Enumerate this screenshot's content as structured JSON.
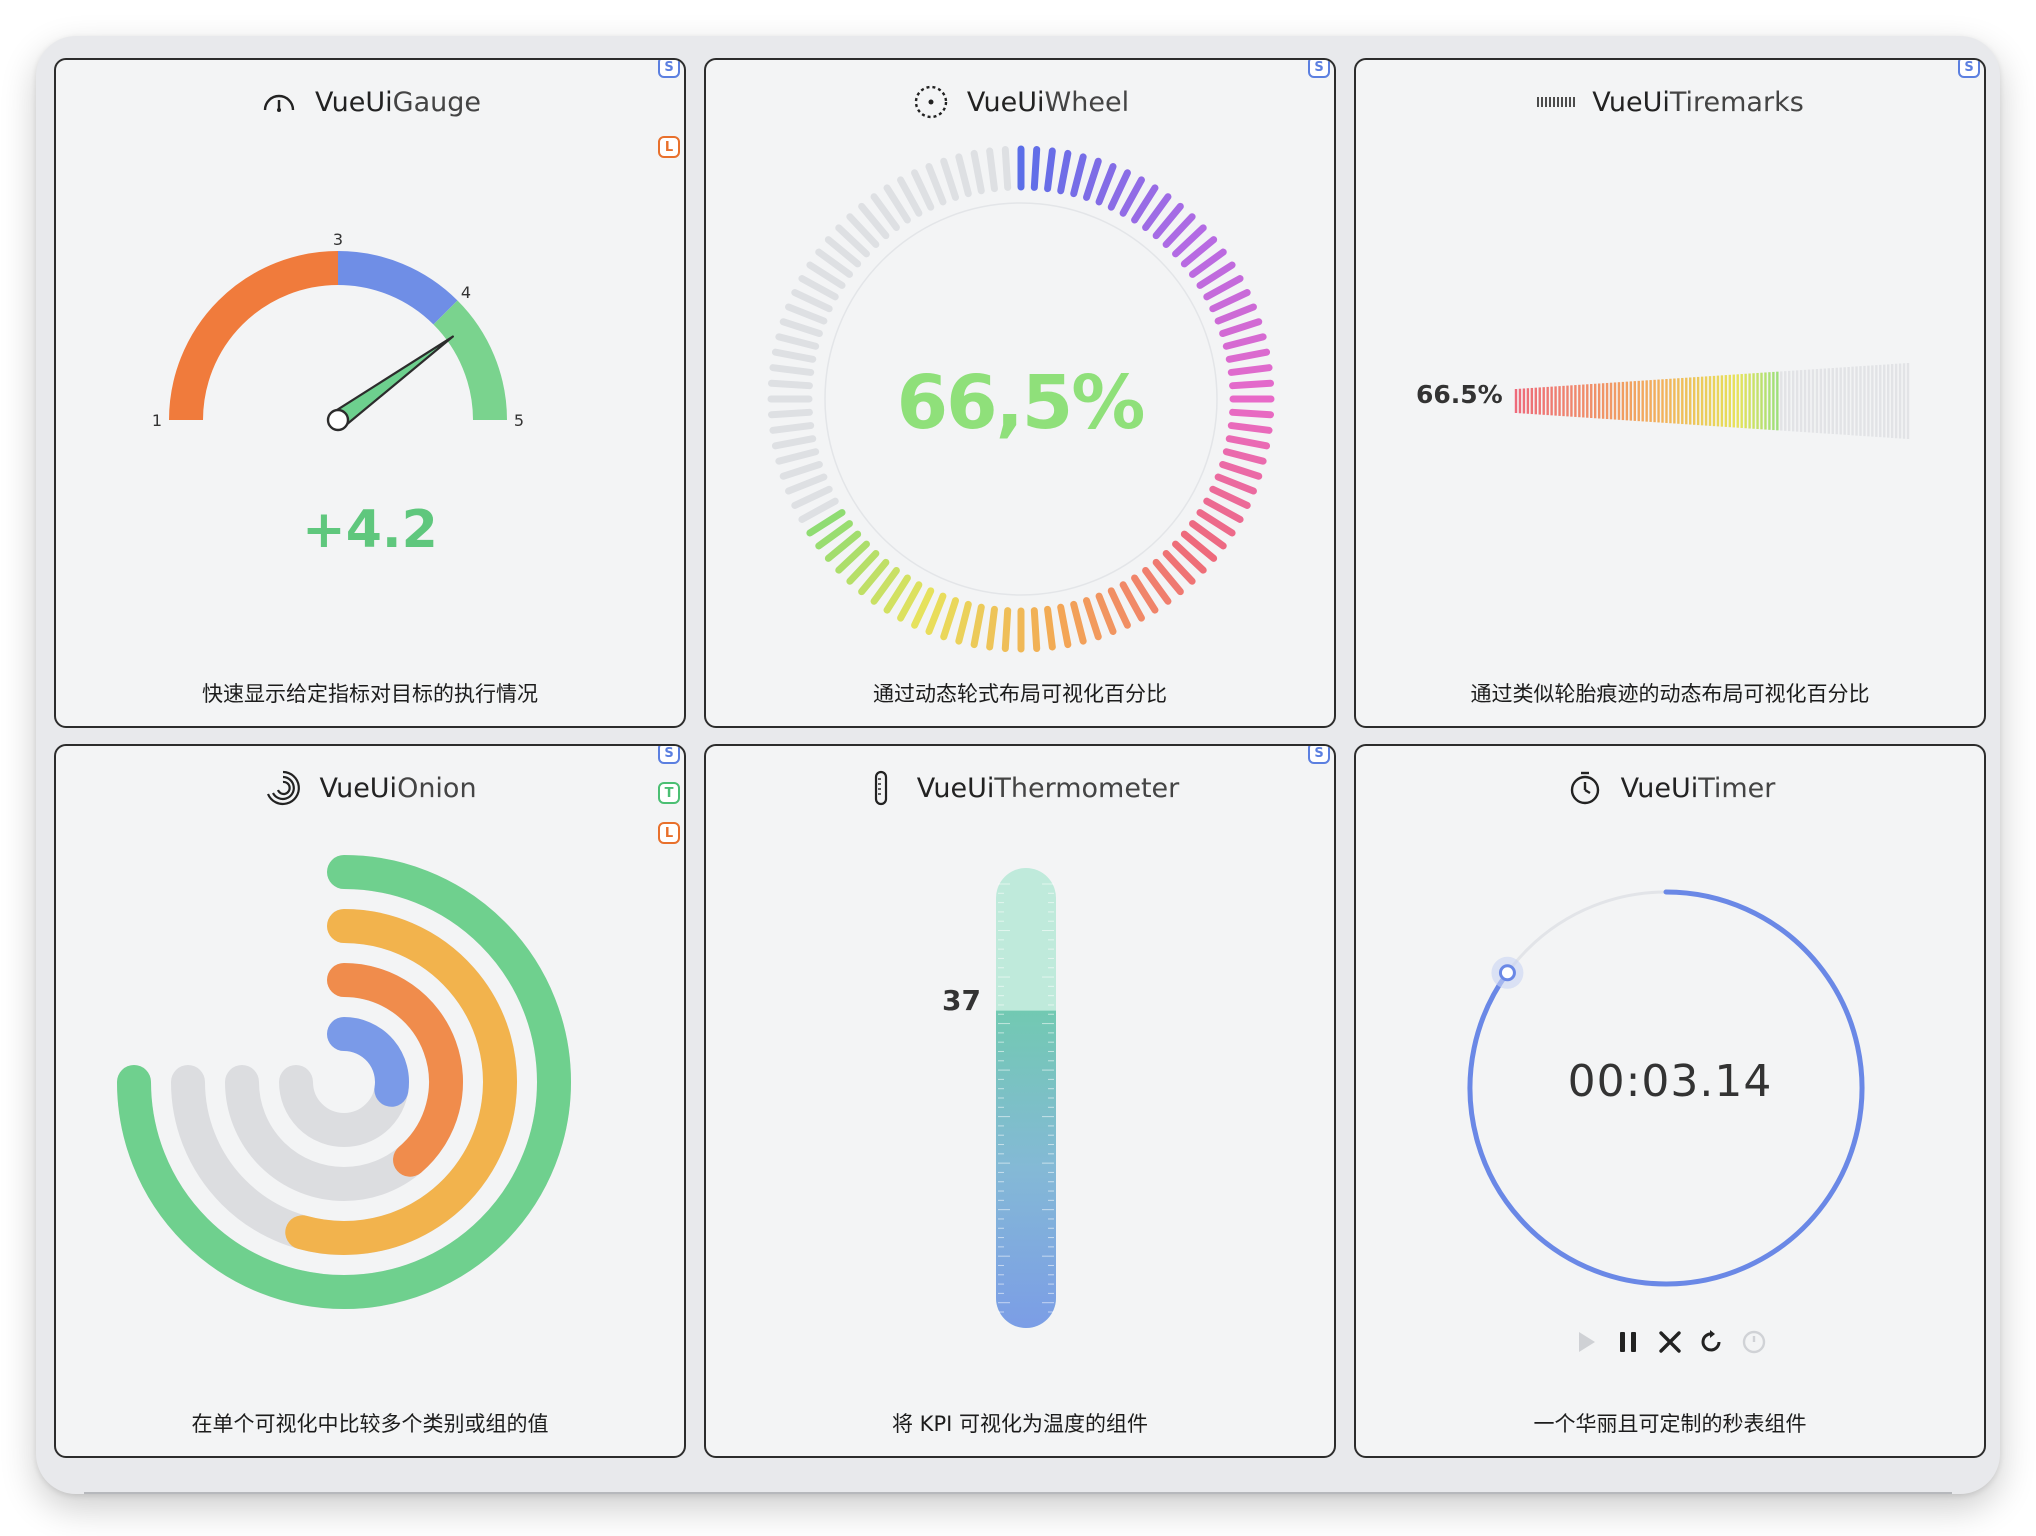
{
  "colors": {
    "card_bg": "#f3f4f5",
    "border": "#2c2c2c",
    "badge_s": "#5b7fe0",
    "badge_t": "#4bbf73",
    "badge_l": "#e8702c",
    "gauge_orange": "#f07b3c",
    "gauge_blue": "#6f8ee6",
    "gauge_green": "#7ad38e",
    "gauge_value": "#5fc77d",
    "wheel_value": "#8fe07a",
    "onion_green": "#6fd08e",
    "onion_yellow": "#f2b34d",
    "onion_orange": "#f08c4c",
    "onion_blue": "#7a9ae8",
    "thermo_top": "#a8e6cd",
    "thermo_bottom": "#7b9de6",
    "timer_ring": "#6a88e6"
  },
  "cards": [
    {
      "id": "gauge",
      "title_prefix": "VueUi",
      "title_suffix": "Gauge",
      "icon": "gauge-icon",
      "description": "快速显示给定指标对目标的执行情况",
      "badges": [
        "S",
        "L"
      ]
    },
    {
      "id": "wheel",
      "title_prefix": "VueUi",
      "title_suffix": "Wheel",
      "icon": "wheel-icon",
      "description": "通过动态轮式布局可视化百分比",
      "badges": [
        "S"
      ]
    },
    {
      "id": "tiremarks",
      "title_prefix": "VueUi",
      "title_suffix": "Tiremarks",
      "icon": "tiremarks-icon",
      "description": "通过类似轮胎痕迹的动态布局可视化百分比",
      "badges": [
        "S"
      ]
    },
    {
      "id": "onion",
      "title_prefix": "VueUi",
      "title_suffix": "Onion",
      "icon": "onion-icon",
      "description": "在单个可视化中比较多个类别或组的值",
      "badges": [
        "S",
        "T",
        "L"
      ]
    },
    {
      "id": "thermometer",
      "title_prefix": "VueUi",
      "title_suffix": "Thermometer",
      "icon": "thermometer-icon",
      "description": "将 KPI 可视化为温度的组件",
      "badges": [
        "S"
      ]
    },
    {
      "id": "timer",
      "title_prefix": "VueUi",
      "title_suffix": "Timer",
      "icon": "stopwatch-icon",
      "description": "一个华丽且可定制的秒表组件",
      "badges": []
    }
  ],
  "gauge": {
    "min": 1,
    "max": 5,
    "segments": [
      {
        "from": 1,
        "to": 3,
        "color": "#f07b3c"
      },
      {
        "from": 3,
        "to": 4,
        "color": "#6f8ee6"
      },
      {
        "from": 4,
        "to": 5,
        "color": "#7ad38e"
      }
    ],
    "tick_labels": [
      "1",
      "3",
      "4",
      "5"
    ],
    "tick_values": [
      1,
      3,
      4,
      5
    ],
    "needle_value": 4.2,
    "value_label": "+4.2"
  },
  "wheel": {
    "percentage": 66.5,
    "value_label": "66,5%",
    "tick_count": 100
  },
  "tiremarks": {
    "percentage": 66.5,
    "value_label": "66.5%"
  },
  "onion": {
    "series": [
      {
        "color": "#6fd08e",
        "fraction": 0.87
      },
      {
        "color": "#f2b34d",
        "fraction": 0.63
      },
      {
        "color": "#f08c4c",
        "fraction": 0.45
      },
      {
        "color": "#7a9ae8",
        "fraction": 0.32
      }
    ]
  },
  "thermometer": {
    "value_label": "37",
    "fill_fraction": 0.69
  },
  "timer": {
    "time_label": "00:03.14",
    "progress_fraction": 0.85,
    "controls": [
      "play-icon",
      "pause-icon",
      "stop-icon",
      "restart-icon",
      "lap-icon"
    ]
  }
}
